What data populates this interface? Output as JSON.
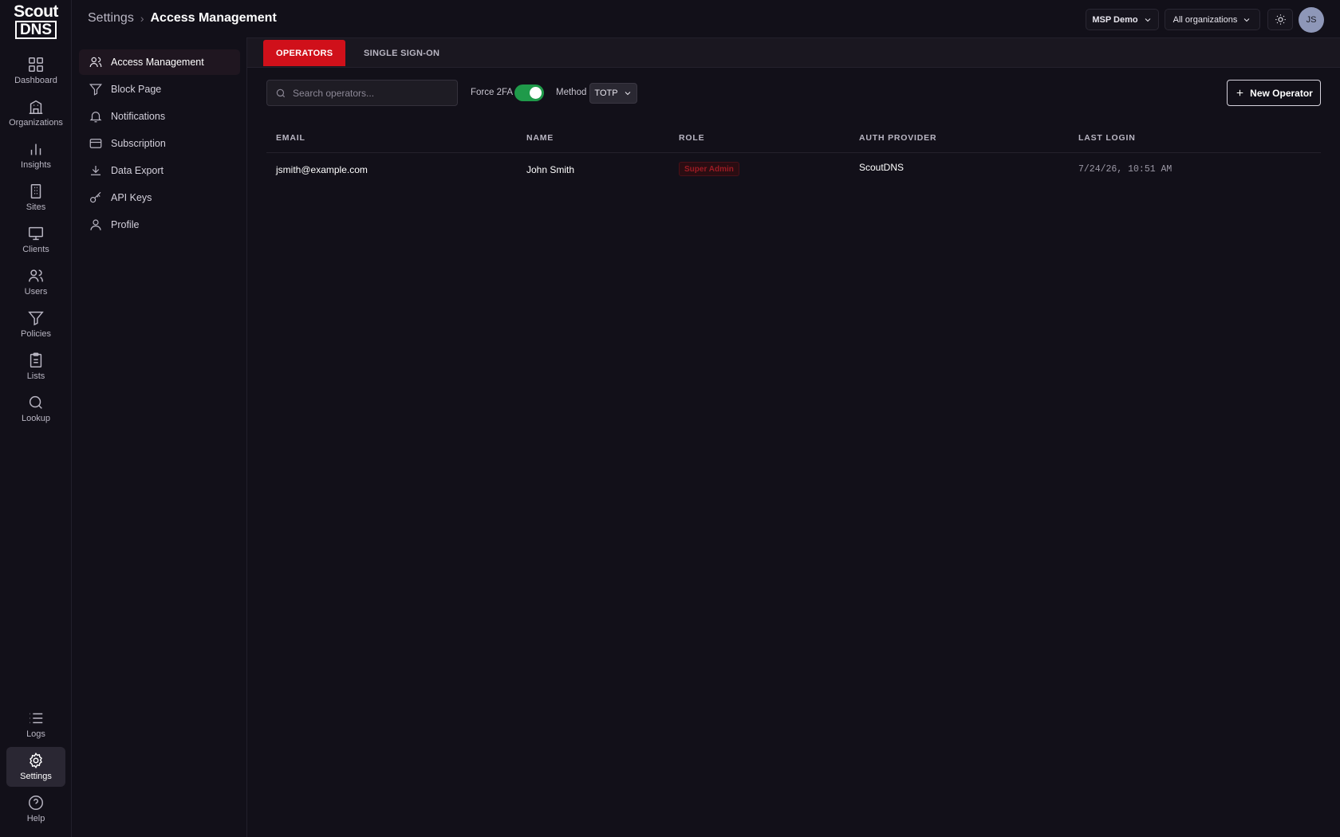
{
  "brand": {
    "line1": "Scout",
    "line2": "DNS"
  },
  "rail": {
    "items": [
      {
        "label": "Dashboard",
        "icon": "grid-icon"
      },
      {
        "label": "Organizations",
        "icon": "building-icon"
      },
      {
        "label": "Insights",
        "icon": "bar-chart-icon"
      },
      {
        "label": "Sites",
        "icon": "office-icon"
      },
      {
        "label": "Clients",
        "icon": "monitor-icon"
      },
      {
        "label": "Users",
        "icon": "users-icon"
      },
      {
        "label": "Policies",
        "icon": "filter-icon"
      },
      {
        "label": "Lists",
        "icon": "clipboard-icon"
      },
      {
        "label": "Lookup",
        "icon": "search-icon"
      }
    ],
    "bottom": [
      {
        "label": "Logs",
        "icon": "list-icon"
      },
      {
        "label": "Settings",
        "icon": "gear-icon",
        "active": true
      },
      {
        "label": "Help",
        "icon": "help-icon"
      }
    ]
  },
  "header": {
    "breadcrumb_root": "Settings",
    "breadcrumb_current": "Access Management",
    "msp_label": "MSP Demo",
    "org_label": "All organizations",
    "avatar_initials": "JS"
  },
  "subnav": {
    "items": [
      {
        "label": "Access Management",
        "icon": "users-icon",
        "active": true
      },
      {
        "label": "Block Page",
        "icon": "filter-icon"
      },
      {
        "label": "Notifications",
        "icon": "bell-icon"
      },
      {
        "label": "Subscription",
        "icon": "card-icon"
      },
      {
        "label": "Data Export",
        "icon": "download-icon"
      },
      {
        "label": "API Keys",
        "icon": "key-icon"
      },
      {
        "label": "Profile",
        "icon": "user-icon"
      }
    ]
  },
  "tabs": [
    {
      "label": "OPERATORS",
      "active": true
    },
    {
      "label": "SINGLE SIGN-ON",
      "active": false
    }
  ],
  "toolbar": {
    "search_placeholder": "Search operators...",
    "force2fa_label": "Force 2FA",
    "force2fa_on": true,
    "method_label": "Method",
    "method_value": "TOTP",
    "new_operator_label": "New Operator"
  },
  "table": {
    "columns": [
      "EMAIL",
      "NAME",
      "ROLE",
      "AUTH PROVIDER",
      "LAST LOGIN"
    ],
    "rows": [
      {
        "email": "jsmith@example.com",
        "name": "John Smith",
        "role": "Super Admin",
        "auth_provider": "ScoutDNS",
        "last_login": "7/24/26, 10:51 AM"
      }
    ]
  },
  "colors": {
    "accent": "#d0101a",
    "toggle_on": "#1f9a4a",
    "background": "#121019"
  }
}
